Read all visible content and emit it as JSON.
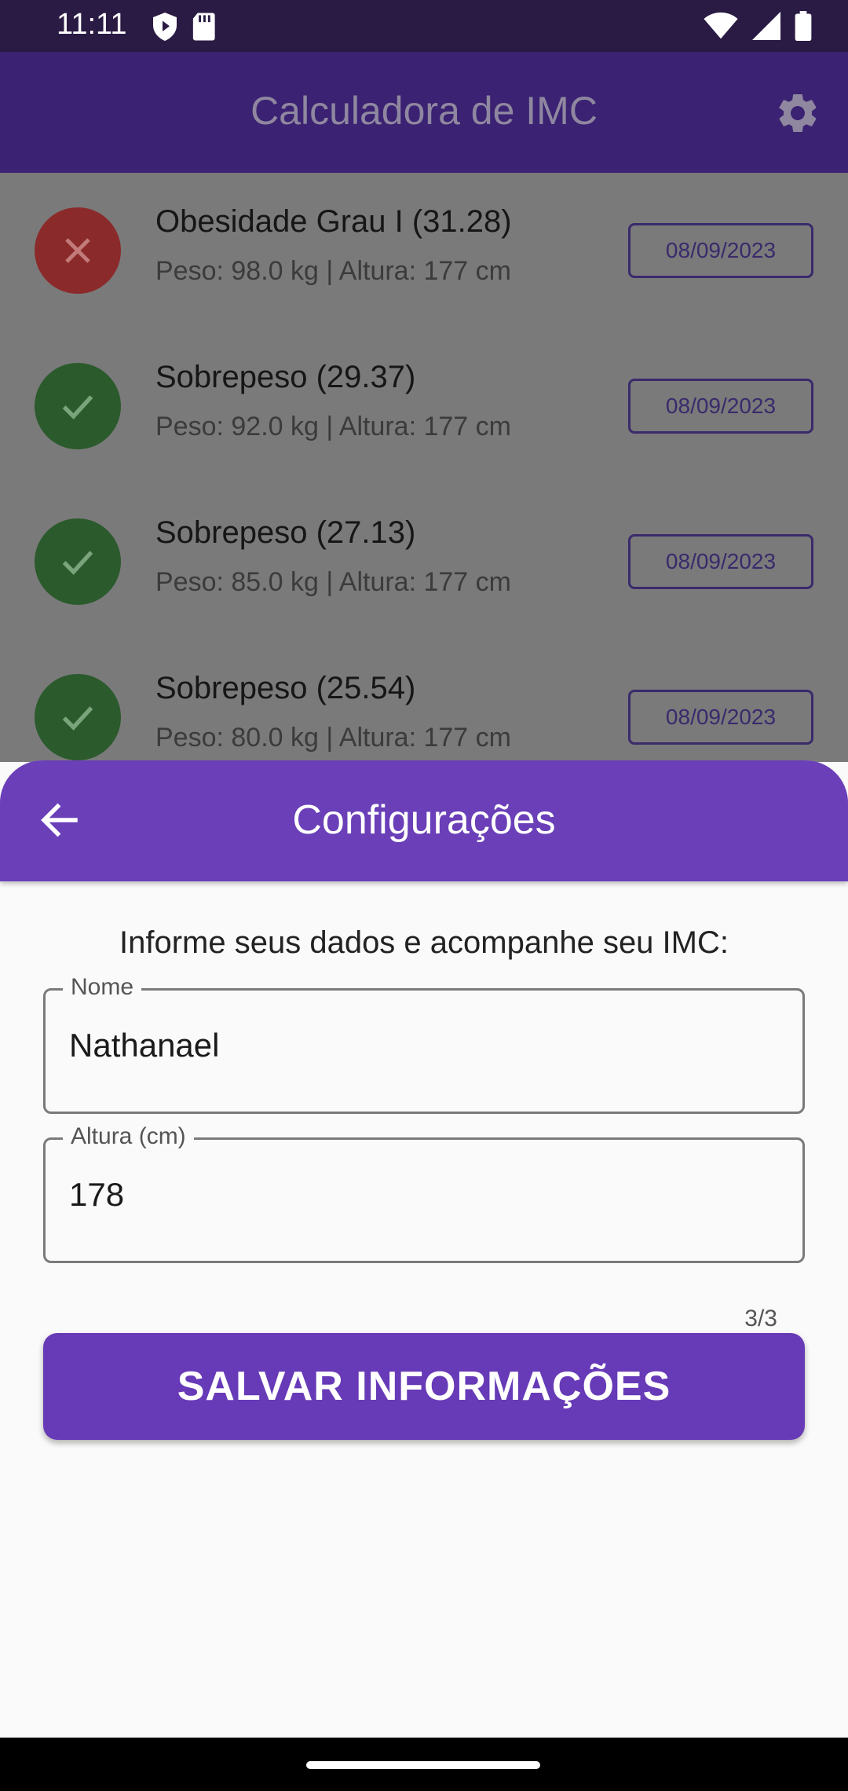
{
  "status_bar": {
    "time": "11:11",
    "icons_left": [
      "shield-icon",
      "sd-card-icon"
    ],
    "icons_right": [
      "wifi-icon",
      "signal-icon",
      "battery-icon"
    ]
  },
  "app_bar": {
    "title": "Calculadora de IMC",
    "settings_icon": "gear-icon",
    "color": "#3b2272"
  },
  "history": {
    "items": [
      {
        "title": "Obesidade Grau I (31.28)",
        "subtitle": "Peso: 98.0 kg | Altura: 177 cm",
        "date": "08/09/2023",
        "status": "bad",
        "icon": "close-icon"
      },
      {
        "title": "Sobrepeso (29.37)",
        "subtitle": "Peso: 92.0 kg | Altura: 177 cm",
        "date": "08/09/2023",
        "status": "ok",
        "icon": "check-icon"
      },
      {
        "title": "Sobrepeso (27.13)",
        "subtitle": "Peso: 85.0 kg | Altura: 177 cm",
        "date": "08/09/2023",
        "status": "ok",
        "icon": "check-icon"
      },
      {
        "title": "Sobrepeso (25.54)",
        "subtitle": "Peso: 80.0 kg | Altura: 177 cm",
        "date": "08/09/2023",
        "status": "ok",
        "icon": "check-icon"
      }
    ]
  },
  "sheet": {
    "title": "Configurações",
    "back_icon": "arrow-back-icon",
    "header_color": "#6a3fb8",
    "intro": "Informe seus dados e acompanhe seu IMC:",
    "name_field": {
      "label": "Nome",
      "value": "Nathanael"
    },
    "height_field": {
      "label": "Altura (cm)",
      "value": "178",
      "counter": "3/3"
    },
    "save_label": "SALVAR INFORMAÇÕES",
    "button_color": "#673ab7"
  }
}
